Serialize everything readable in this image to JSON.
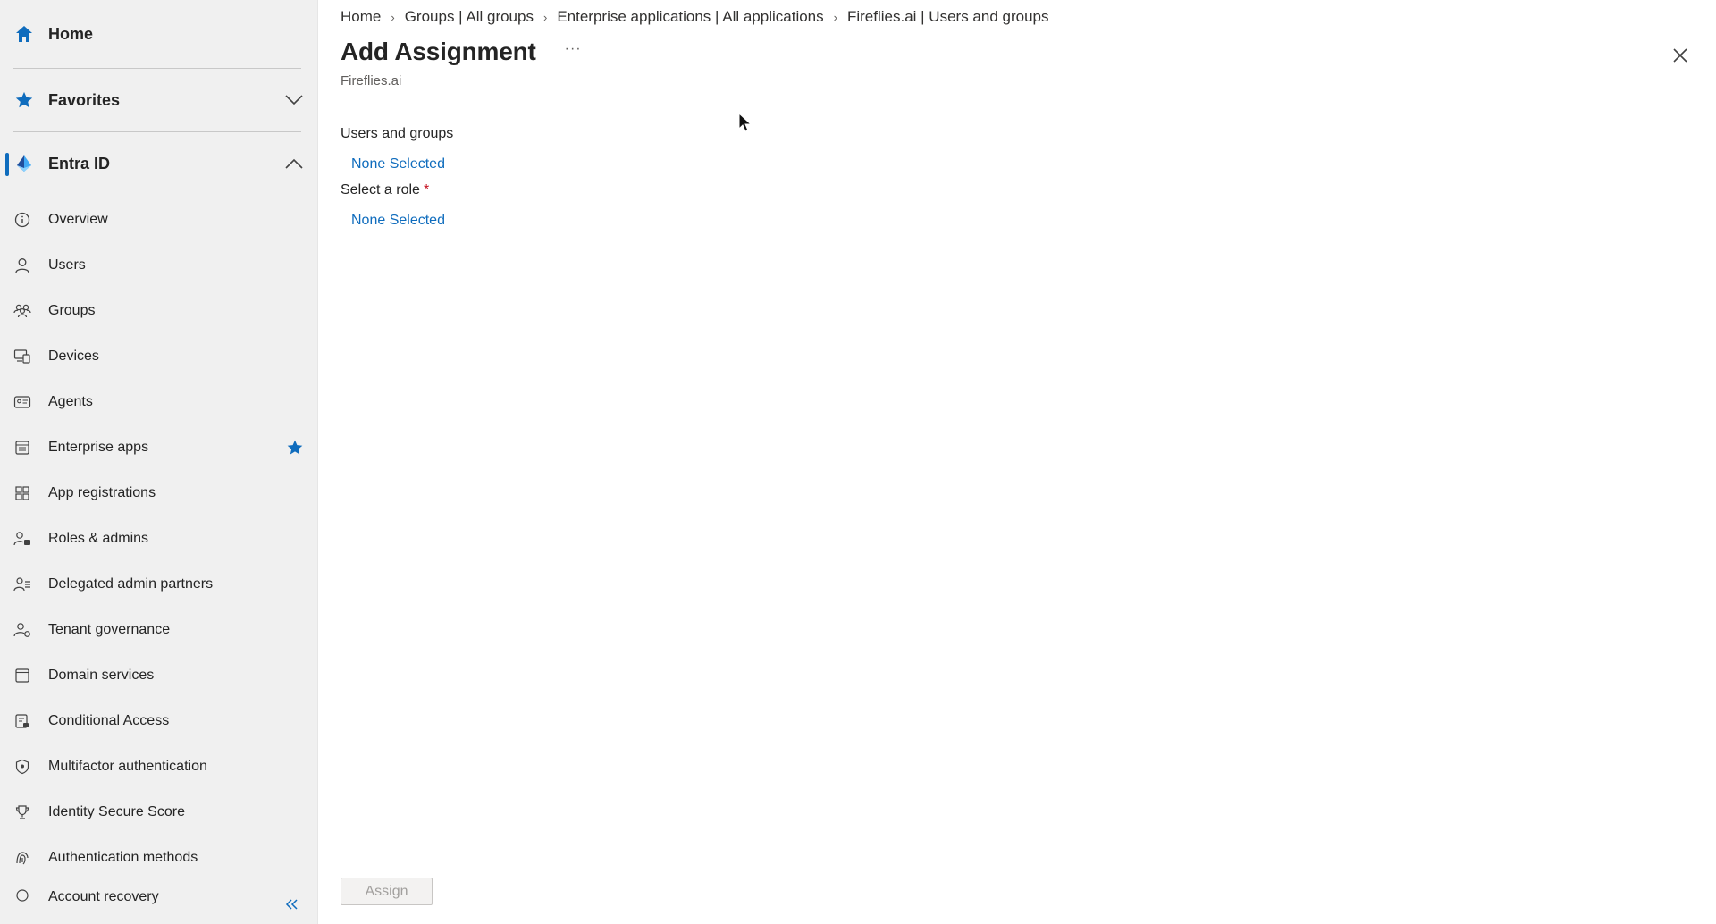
{
  "sidebar": {
    "home_label": "Home",
    "favorites_label": "Favorites",
    "section_label": "Entra ID",
    "items": [
      {
        "label": "Overview",
        "icon": "info-icon"
      },
      {
        "label": "Users",
        "icon": "user-icon"
      },
      {
        "label": "Groups",
        "icon": "groups-icon"
      },
      {
        "label": "Devices",
        "icon": "devices-icon"
      },
      {
        "label": "Agents",
        "icon": "agents-icon"
      },
      {
        "label": "Enterprise apps",
        "icon": "enterprise-apps-icon",
        "favorited": true
      },
      {
        "label": "App registrations",
        "icon": "app-registrations-icon"
      },
      {
        "label": "Roles & admins",
        "icon": "roles-icon"
      },
      {
        "label": "Delegated admin partners",
        "icon": "partners-icon"
      },
      {
        "label": "Tenant governance",
        "icon": "governance-icon"
      },
      {
        "label": "Domain services",
        "icon": "domain-icon"
      },
      {
        "label": "Conditional Access",
        "icon": "conditional-access-icon"
      },
      {
        "label": "Multifactor authentication",
        "icon": "shield-icon"
      },
      {
        "label": "Identity Secure Score",
        "icon": "trophy-icon"
      },
      {
        "label": "Authentication methods",
        "icon": "auth-methods-icon"
      },
      {
        "label": "Account recovery",
        "icon": "recovery-icon"
      }
    ]
  },
  "breadcrumb": [
    "Home",
    "Groups | All groups",
    "Enterprise applications | All applications",
    "Fireflies.ai | Users and groups"
  ],
  "page": {
    "title": "Add Assignment",
    "more": "···",
    "subtitle": "Fireflies.ai"
  },
  "form": {
    "users_label": "Users and groups",
    "users_value": "None Selected",
    "role_label": "Select a role",
    "role_required": "*",
    "role_value": "None Selected"
  },
  "footer": {
    "assign_label": "Assign"
  },
  "colors": {
    "accent": "#0f6cbd",
    "sidebar_bg": "#f0f0f0",
    "required": "#c50f1f"
  }
}
